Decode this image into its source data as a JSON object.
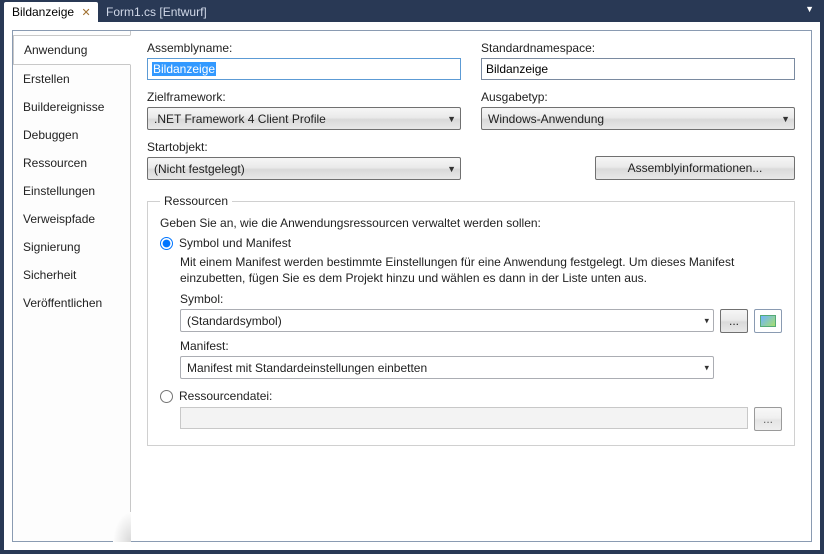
{
  "tabs": [
    {
      "label": "Bildanzeige",
      "active": true
    },
    {
      "label": "Form1.cs [Entwurf]",
      "active": false
    }
  ],
  "nav": {
    "items": [
      "Anwendung",
      "Erstellen",
      "Buildereignisse",
      "Debuggen",
      "Ressourcen",
      "Einstellungen",
      "Verweispfade",
      "Signierung",
      "Sicherheit",
      "Veröffentlichen"
    ],
    "activeIndex": 0
  },
  "content": {
    "assemblyname_label": "Assemblyname:",
    "assemblyname_value": "Bildanzeige",
    "defaultnamespace_label": "Standardnamespace:",
    "defaultnamespace_value": "Bildanzeige",
    "targetframework_label": "Zielframework:",
    "targetframework_value": ".NET Framework 4 Client Profile",
    "outputtype_label": "Ausgabetyp:",
    "outputtype_value": "Windows-Anwendung",
    "startobject_label": "Startobjekt:",
    "startobject_value": "(Nicht festgelegt)",
    "assemblyinfo_button": "Assemblyinformationen...",
    "resources_legend": "Ressourcen",
    "resources_instruction": "Geben Sie an, wie die Anwendungsressourcen verwaltet werden sollen:",
    "radio_icon_manifest": "Symbol und Manifest",
    "icon_manifest_help": "Mit einem Manifest werden bestimmte Einstellungen für eine Anwendung festgelegt. Um dieses Manifest einzubetten, fügen Sie es dem Projekt hinzu und wählen es dann in der Liste unten aus.",
    "symbol_label": "Symbol:",
    "symbol_value": "(Standardsymbol)",
    "browse_ellipsis": "...",
    "manifest_label": "Manifest:",
    "manifest_value": "Manifest mit Standardeinstellungen einbetten",
    "radio_resourcefile": "Ressourcendatei:"
  }
}
